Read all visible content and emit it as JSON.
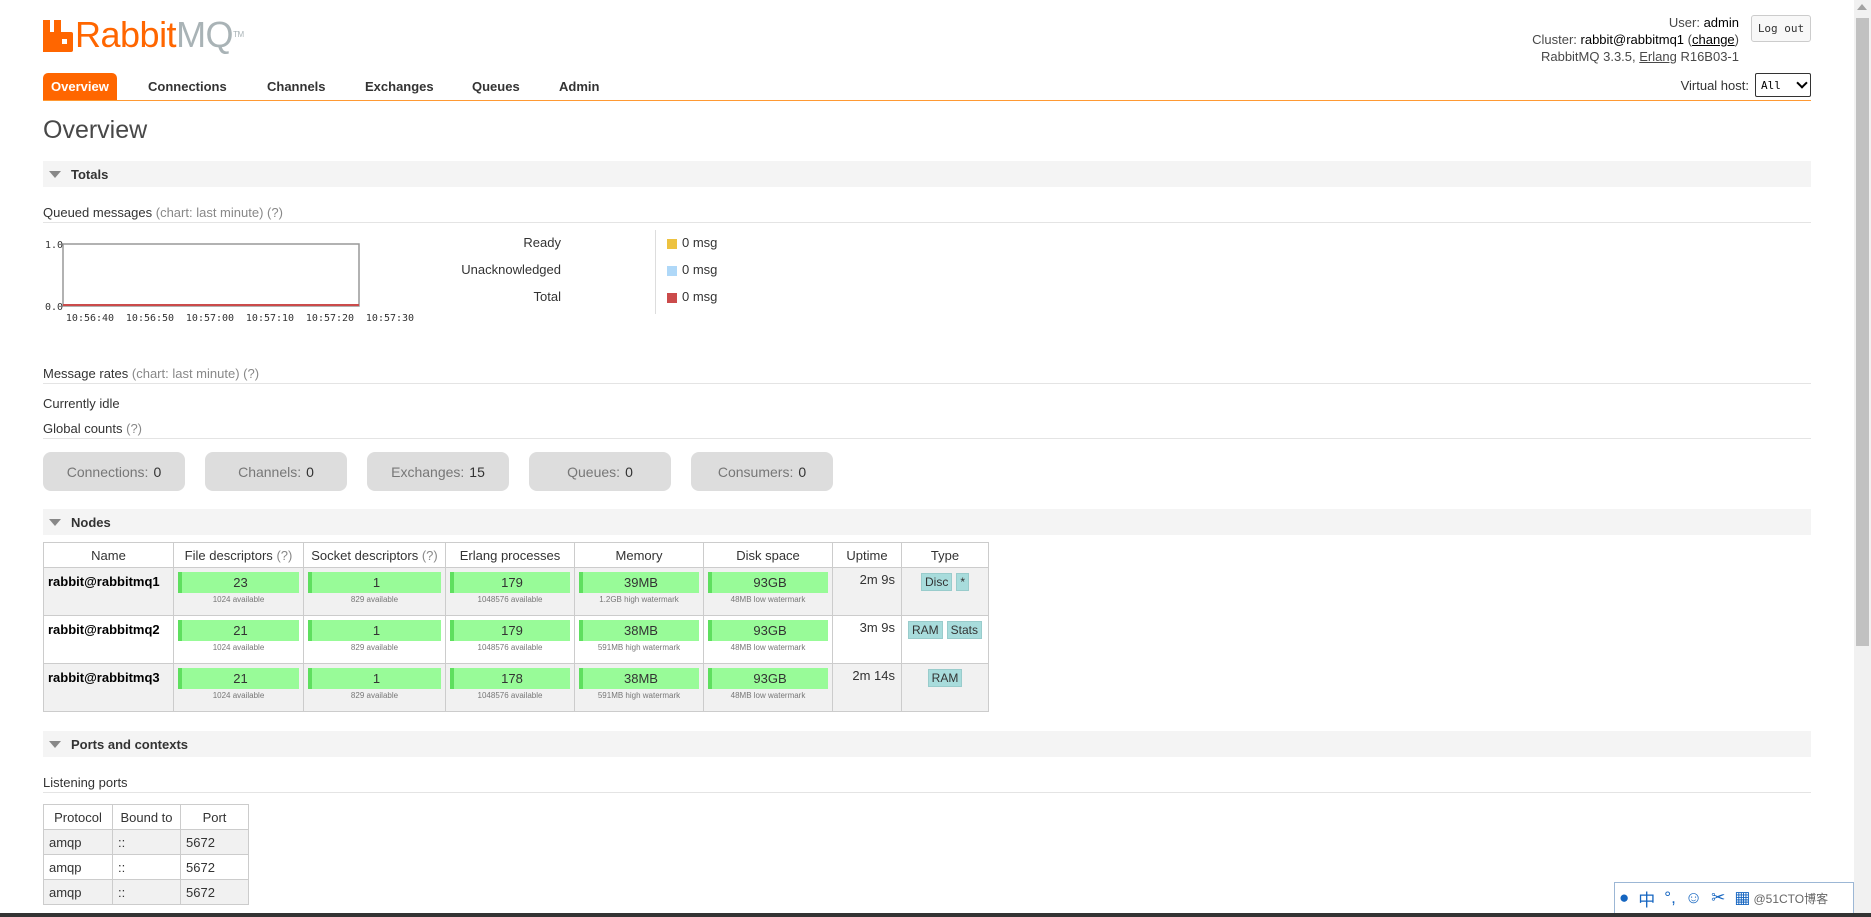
{
  "logo": {
    "rabbit": "Rabbit",
    "mq": "MQ",
    "tm": "TM"
  },
  "login": {
    "user_label": "User:",
    "user": "admin",
    "cluster_label": "Cluster:",
    "cluster": "rabbit@rabbitmq1",
    "change": "change",
    "version": "RabbitMQ 3.3.5,",
    "erlang_label": "Erlang",
    "erlang_version": "R16B03-1",
    "logout": "Log out"
  },
  "vhost": {
    "label": "Virtual host:",
    "selected": "All"
  },
  "tabs": [
    "Overview",
    "Connections",
    "Channels",
    "Exchanges",
    "Queues",
    "Admin"
  ],
  "page_title": "Overview",
  "sections": {
    "totals": "Totals",
    "nodes": "Nodes",
    "ports": "Ports and contexts"
  },
  "queued": {
    "title": "Queued messages",
    "hint": "(chart: last minute) (?)"
  },
  "chart_data": {
    "type": "line",
    "x": [
      "10:56:40",
      "10:56:50",
      "10:57:00",
      "10:57:10",
      "10:57:20",
      "10:57:30"
    ],
    "ylim": [
      0.0,
      1.0
    ],
    "y_ticks": [
      "1.0",
      "0.0"
    ],
    "series": [
      {
        "name": "Ready",
        "color": "#edc240",
        "values": [
          0,
          0,
          0,
          0,
          0,
          0
        ]
      },
      {
        "name": "Unacknowledged",
        "color": "#afd8f8",
        "values": [
          0,
          0,
          0,
          0,
          0,
          0
        ]
      },
      {
        "name": "Total",
        "color": "#cb4b4b",
        "values": [
          0,
          0,
          0,
          0,
          0,
          0
        ]
      }
    ],
    "legend_values": [
      "0 msg",
      "0 msg",
      "0 msg"
    ]
  },
  "rates": {
    "title": "Message rates",
    "hint": "(chart: last minute) (?)",
    "idle": "Currently idle"
  },
  "global": {
    "title": "Global counts",
    "hint": "(?)"
  },
  "counts": [
    {
      "label": "Connections:",
      "value": "0"
    },
    {
      "label": "Channels:",
      "value": "0"
    },
    {
      "label": "Exchanges:",
      "value": "15"
    },
    {
      "label": "Queues:",
      "value": "0"
    },
    {
      "label": "Consumers:",
      "value": "0"
    }
  ],
  "nodes": {
    "headers": [
      "Name",
      "File descriptors",
      "Socket descriptors",
      "Erlang processes",
      "Memory",
      "Disk space",
      "Uptime",
      "Type"
    ],
    "hint": "(?)",
    "rows": [
      {
        "name": "rabbit@rabbitmq1",
        "fd": "23",
        "fd_sub": "1024 available",
        "sd": "1",
        "sd_sub": "829 available",
        "ep": "179",
        "ep_sub": "1048576 available",
        "mem": "39MB",
        "mem_sub": "1.2GB high watermark",
        "disk": "93GB",
        "disk_sub": "48MB low watermark",
        "uptime": "2m 9s",
        "types": [
          "Disc",
          "*"
        ]
      },
      {
        "name": "rabbit@rabbitmq2",
        "fd": "21",
        "fd_sub": "1024 available",
        "sd": "1",
        "sd_sub": "829 available",
        "ep": "179",
        "ep_sub": "1048576 available",
        "mem": "38MB",
        "mem_sub": "591MB high watermark",
        "disk": "93GB",
        "disk_sub": "48MB low watermark",
        "uptime": "3m 9s",
        "types": [
          "RAM",
          "Stats"
        ]
      },
      {
        "name": "rabbit@rabbitmq3",
        "fd": "21",
        "fd_sub": "1024 available",
        "sd": "1",
        "sd_sub": "829 available",
        "ep": "178",
        "ep_sub": "1048576 available",
        "mem": "38MB",
        "mem_sub": "591MB high watermark",
        "disk": "93GB",
        "disk_sub": "48MB low watermark",
        "uptime": "2m 14s",
        "types": [
          "RAM"
        ]
      }
    ]
  },
  "ports": {
    "title": "Listening ports",
    "headers": [
      "Protocol",
      "Bound to",
      "Port"
    ],
    "rows": [
      [
        "amqp",
        "::",
        "5672"
      ],
      [
        "amqp",
        "::",
        "5672"
      ],
      [
        "amqp",
        "::",
        "5672"
      ]
    ]
  },
  "ime": {
    "mode": "中",
    "watermark": "@51CTO博客"
  }
}
